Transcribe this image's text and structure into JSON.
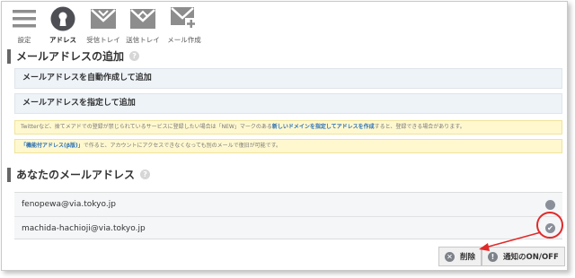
{
  "toolbar": {
    "items": [
      {
        "label": "設定",
        "icon": "hamburger-menu-icon"
      },
      {
        "label": "アドレス",
        "icon": "keyhole-icon"
      },
      {
        "label": "受信トレイ",
        "icon": "inbox-envelope-icon"
      },
      {
        "label": "送信トレイ",
        "icon": "outbox-envelope-icon"
      },
      {
        "label": "メール作成",
        "icon": "compose-envelope-icon"
      }
    ]
  },
  "add_section": {
    "title": "メールアドレスの追加",
    "help": "?",
    "auto_create_label": "メールアドレスを自動作成して追加",
    "specify_label": "メールアドレスを指定して追加",
    "notice1_before": "Twitterなど、捨てメアドでの登録が禁じられているサービスに登録したい場合は「NEW」マークのある",
    "notice1_link": "新しいドメインを指定してアドレスを作成",
    "notice1_after": "すると、登録できる場合があります。",
    "notice2_link": "「機能付アドレス(β版)」",
    "notice2_after": "で作ると、アカウントにアクセスできなくなっても別のメールで復旧が可能です。"
  },
  "address_section": {
    "title": "あなたのメールアドレス",
    "help": "?",
    "addresses": [
      {
        "email": "fenopewa@via.tokyo.jp",
        "status": "dot"
      },
      {
        "email": "machida-hachioji@via.tokyo.jp",
        "status": "check",
        "check_glyph": "✔"
      }
    ]
  },
  "buttons": {
    "delete_label": "削除",
    "delete_glyph": "✕",
    "notify_label": "通知のON/OFF",
    "notify_glyph": "!"
  },
  "colors": {
    "accent_red": "#e12a2a",
    "link_blue": "#2a6fb5",
    "notice_bg": "#fff8cf",
    "action_bg": "#eef3f8"
  }
}
